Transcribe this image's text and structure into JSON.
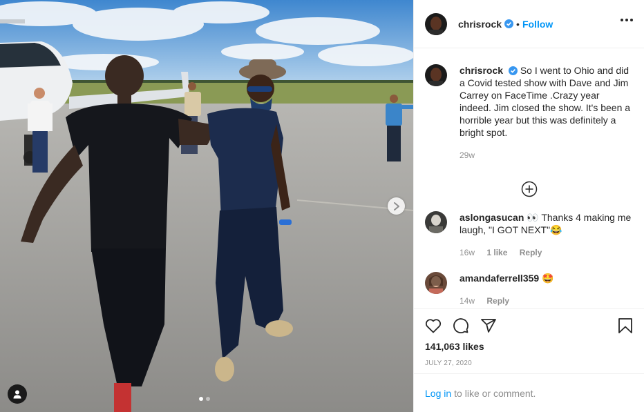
{
  "post": {
    "username": "chrisrock",
    "follow_label": "Follow",
    "separator": "•",
    "caption": "So I went to Ohio and did a Covid tested show with Dave and Jim Carrey on FaceTime .Crazy year indeed. Jim closed the show. It's been a horrible year but this was definitely a bright spot.",
    "caption_age": "29w"
  },
  "comments": [
    {
      "username": "aslongasucan",
      "text": "👀 Thanks 4 making me laugh, \"I GOT NEXT\"😂",
      "age": "16w",
      "likes": "1 like",
      "reply": "Reply"
    },
    {
      "username": "amandaferrell359",
      "text": "🤩",
      "age": "14w",
      "reply": "Reply"
    }
  ],
  "stats": {
    "likes": "141,063 likes",
    "date": "JULY 27, 2020"
  },
  "footer": {
    "login_link": "Log in",
    "login_text": "to like or comment."
  },
  "colors": {
    "accent": "#0095f6",
    "muted": "#8e8e8e",
    "text": "#262626"
  },
  "icons": [
    "verified-badge-icon",
    "more-options-icon",
    "load-more-comments-icon",
    "heart-icon",
    "comment-icon",
    "share-icon",
    "bookmark-icon",
    "next-arrow-icon",
    "tagged-user-icon"
  ],
  "carousel": {
    "slide_count": 2,
    "active_slide": 1
  }
}
